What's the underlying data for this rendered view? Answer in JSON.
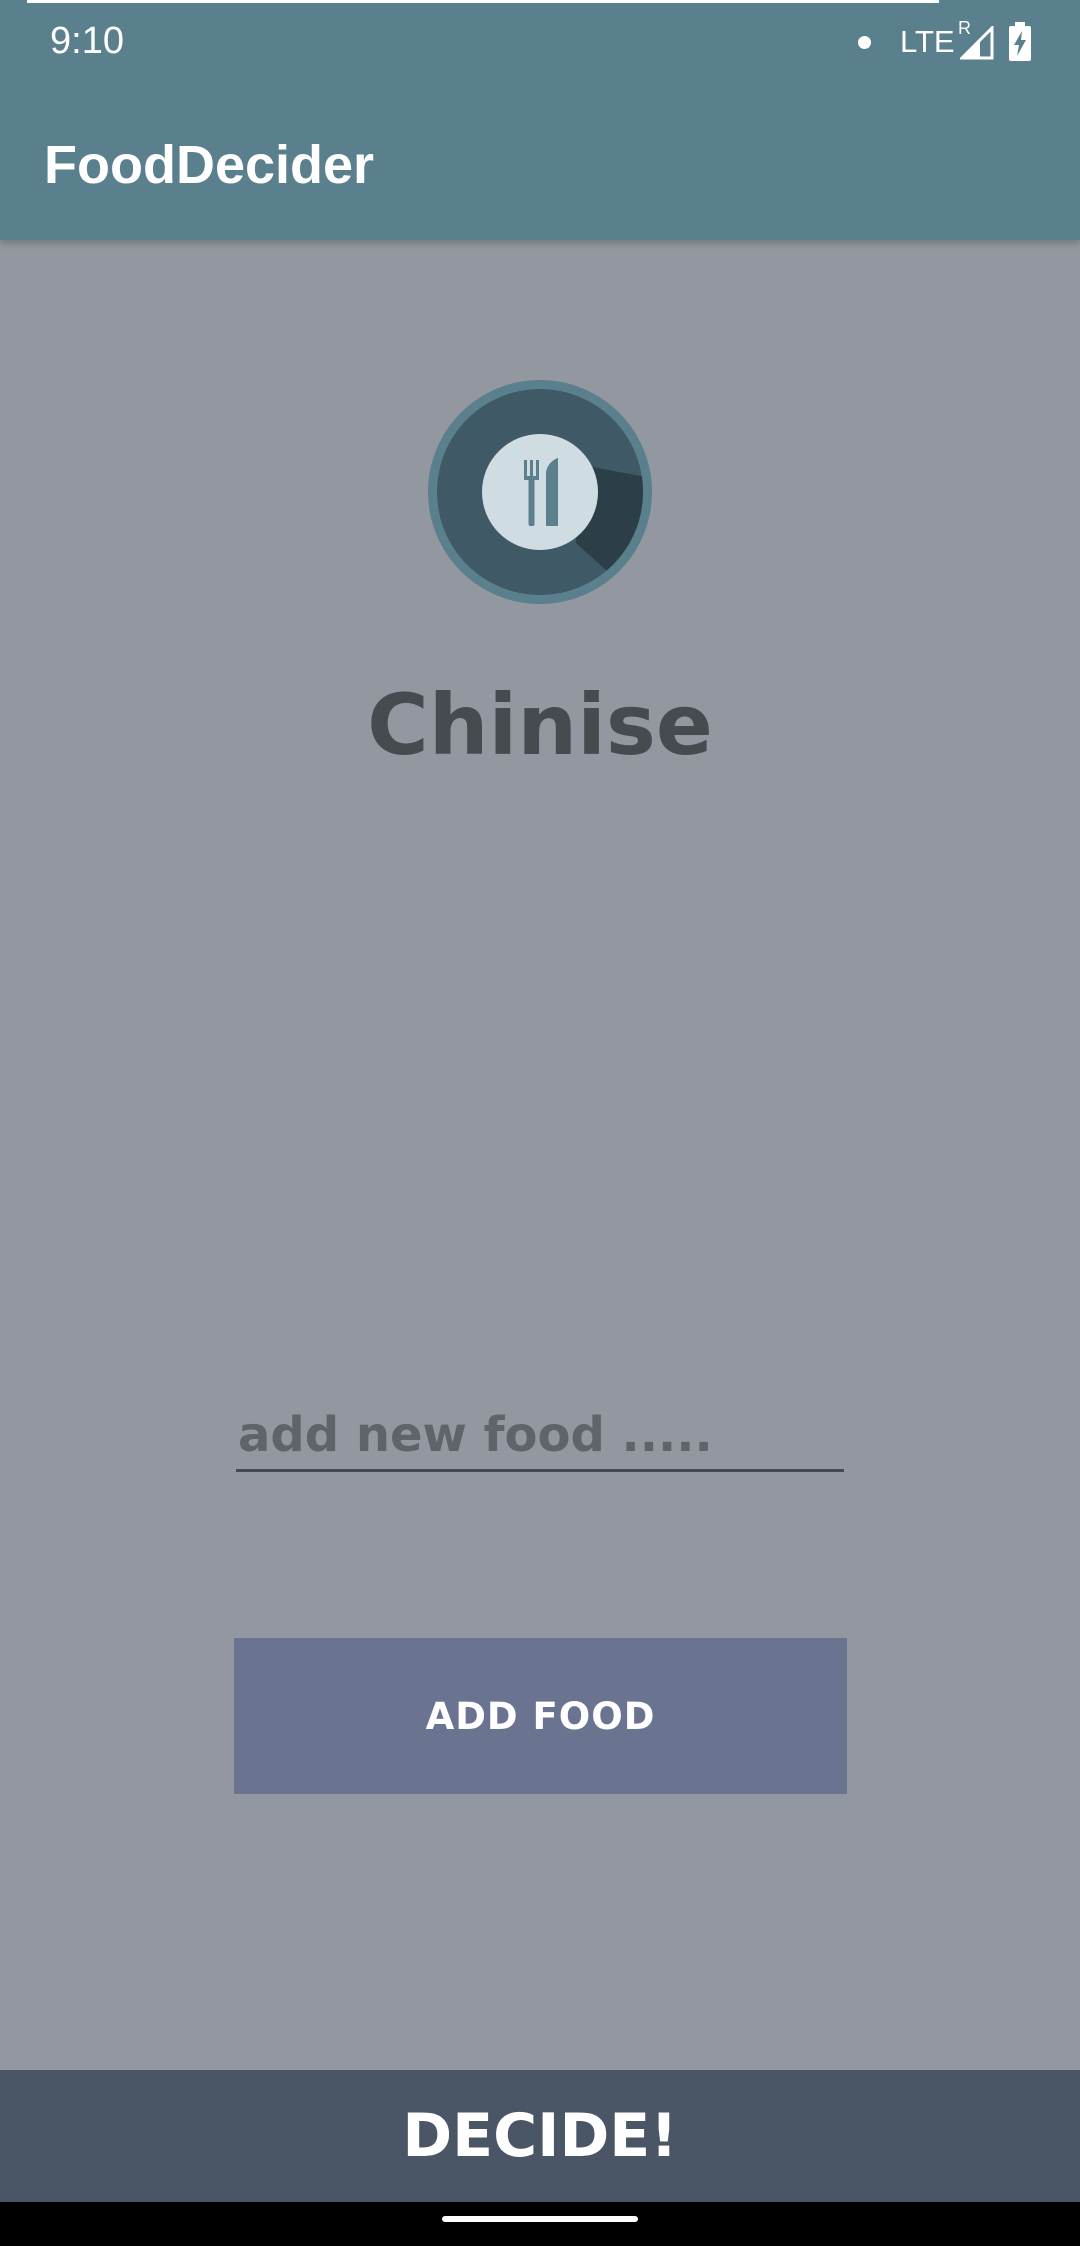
{
  "status_bar": {
    "time": "9:10",
    "network": "LTE",
    "roaming": "R",
    "icons": [
      "notification-dot-icon",
      "signal-icon",
      "battery-charging-icon"
    ]
  },
  "app_bar": {
    "title": "FoodDecider"
  },
  "main": {
    "logo_icon": "fork-knife-icon",
    "result": "Chinise",
    "input": {
      "value": "",
      "placeholder": "add new food ....."
    },
    "add_button_label": "ADD FOOD"
  },
  "decide_button_label": "DECIDE!",
  "nav_bar": {
    "home_handle": "home-handle"
  },
  "colors": {
    "primary": "#5a808e",
    "background": "#93979f",
    "add_button": "#6a7490",
    "decide_bar": "#4a5565",
    "result_text": "#474a4f"
  }
}
